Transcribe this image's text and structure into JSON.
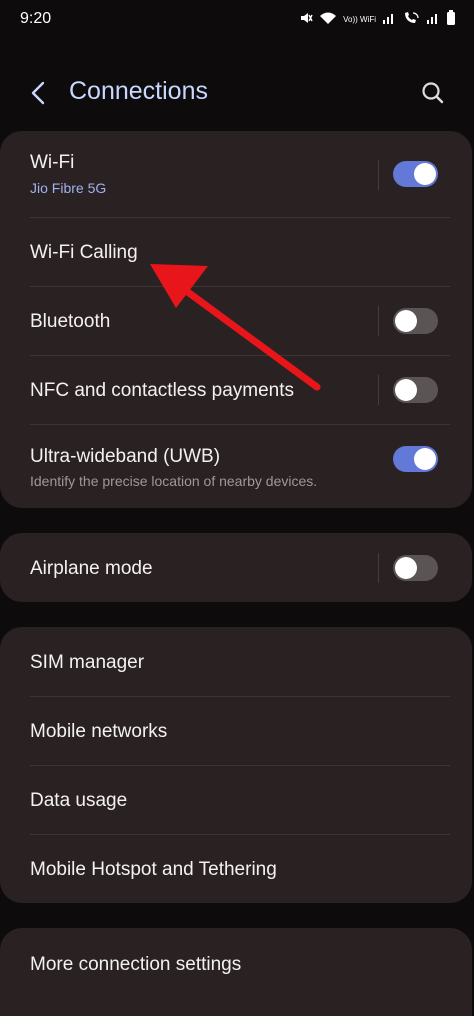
{
  "status_bar": {
    "time": "9:20",
    "icons": [
      "mute-icon",
      "wifi-icon",
      "vowifi-icon",
      "signal-icon",
      "wifi-calling-icon",
      "signal-icon-2",
      "battery-icon"
    ],
    "vowifi_text": "Vo)) WiFi"
  },
  "header": {
    "title": "Connections",
    "title_color": "#c9d6ff"
  },
  "group1": {
    "wifi": {
      "label": "Wi-Fi",
      "subtitle": "Jio Fibre 5G",
      "toggle": "on"
    },
    "wifi_calling": {
      "label": "Wi-Fi Calling"
    },
    "bluetooth": {
      "label": "Bluetooth",
      "toggle": "off"
    },
    "nfc": {
      "label": "NFC and contactless payments",
      "toggle": "off"
    },
    "uwb": {
      "label": "Ultra-wideband (UWB)",
      "subtitle": "Identify the precise location of nearby devices.",
      "toggle": "on"
    }
  },
  "group2": {
    "airplane": {
      "label": "Airplane mode",
      "toggle": "off"
    }
  },
  "group3": {
    "items": [
      {
        "label": "SIM manager"
      },
      {
        "label": "Mobile networks"
      },
      {
        "label": "Data usage"
      },
      {
        "label": "Mobile Hotspot and Tethering"
      }
    ]
  },
  "group4": {
    "more": {
      "label": "More connection settings"
    }
  },
  "colors": {
    "background": "#0d0b0b",
    "card": "#2a2222",
    "toggle_on": "#6379d8",
    "toggle_off": "#5a5454",
    "annotation_arrow": "#e8161b",
    "subtitle_accent": "#9fb1f0"
  }
}
